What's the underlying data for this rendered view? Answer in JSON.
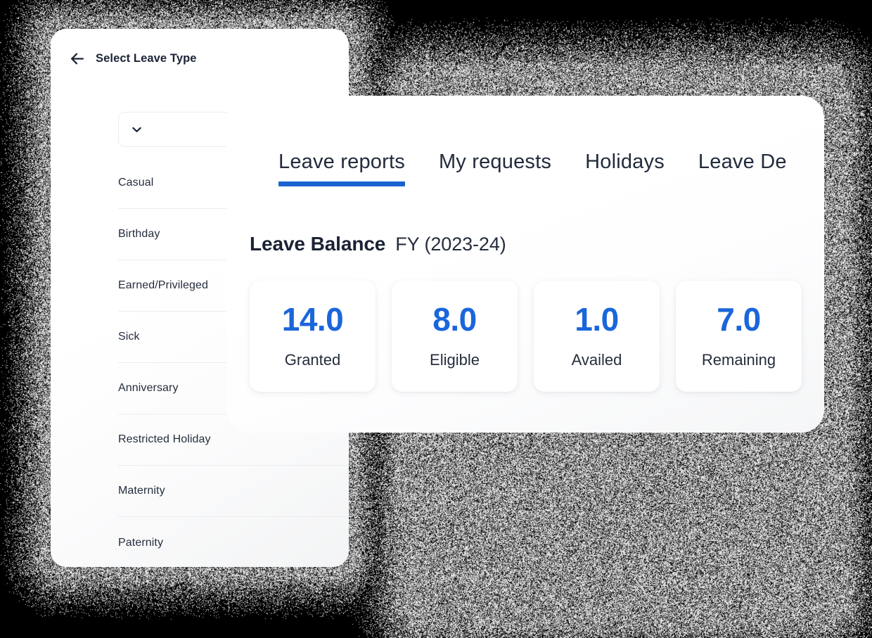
{
  "theme": {
    "accent_blue": "#1a66db",
    "tab_underline_blue": "#1a62d0",
    "text_dark": "#1b2234",
    "backdrop": "#000000",
    "card_white": "#ffffff"
  },
  "leave_type_panel": {
    "back_icon": "arrow-left-icon",
    "title": "Select Leave Type",
    "select": {
      "value": "",
      "placeholder": "",
      "chevron_icon": "chevron-down-icon"
    },
    "items": [
      {
        "label": "Casual"
      },
      {
        "label": "Birthday"
      },
      {
        "label": "Earned/Privileged"
      },
      {
        "label": "Sick"
      },
      {
        "label": "Anniversary"
      },
      {
        "label": "Restricted Holiday"
      },
      {
        "label": "Maternity"
      },
      {
        "label": "Paternity"
      }
    ]
  },
  "reports_panel": {
    "tabs": [
      {
        "label": "Leave reports",
        "active": true
      },
      {
        "label": "My requests",
        "active": false
      },
      {
        "label": "Holidays",
        "active": false
      },
      {
        "label": "Leave De",
        "active": false
      }
    ],
    "balance": {
      "heading": "Leave Balance",
      "period": "FY (2023-24)",
      "stats": [
        {
          "value": "14.0",
          "label": "Granted"
        },
        {
          "value": "8.0",
          "label": "Eligible"
        },
        {
          "value": "1.0",
          "label": "Availed"
        },
        {
          "value": "7.0",
          "label": "Remaining"
        }
      ]
    }
  }
}
